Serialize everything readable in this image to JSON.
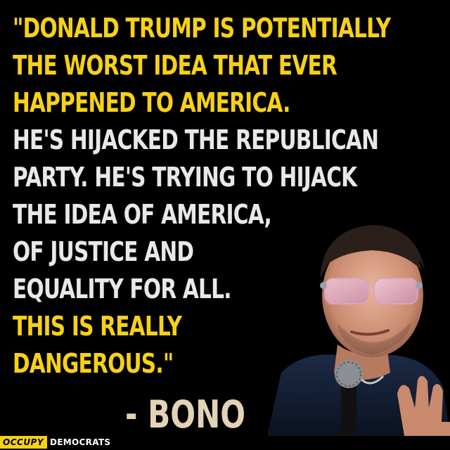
{
  "quote": {
    "lines": [
      {
        "text": "\"DONALD TRUMP IS POTENTIALLY",
        "color": "#f7d117"
      },
      {
        "text": "THE WORST IDEA THAT EVER",
        "color": "#f7d117"
      },
      {
        "text": "HAPPENED TO AMERICA.",
        "color": "#f7d117"
      },
      {
        "text": "HE'S HIJACKED THE REPUBLICAN",
        "color": "#e8e8e8"
      },
      {
        "text": "PARTY. HE'S TRYING TO HIJACK",
        "color": "#e8e8e8"
      },
      {
        "text": "THE IDEA OF AMERICA,",
        "color": "#e8e8e8"
      },
      {
        "text": "OF JUSTICE AND",
        "color": "#e8e8e8"
      },
      {
        "text": "EQUALITY FOR ALL.",
        "color": "#e8e8e8"
      },
      {
        "text": "THIS IS REALLY",
        "color": "#f7d117"
      },
      {
        "text": "DANGEROUS.\"",
        "color": "#f7d117"
      }
    ]
  },
  "attribution": "- BONO",
  "brand": {
    "occupy": "OCCUPY",
    "democrats": "DEMOCRATS"
  },
  "colors": {
    "background": "#000000",
    "accent_yellow": "#f7d117",
    "quote_white": "#e8e8e8",
    "attribution": "#e4d2b6"
  }
}
